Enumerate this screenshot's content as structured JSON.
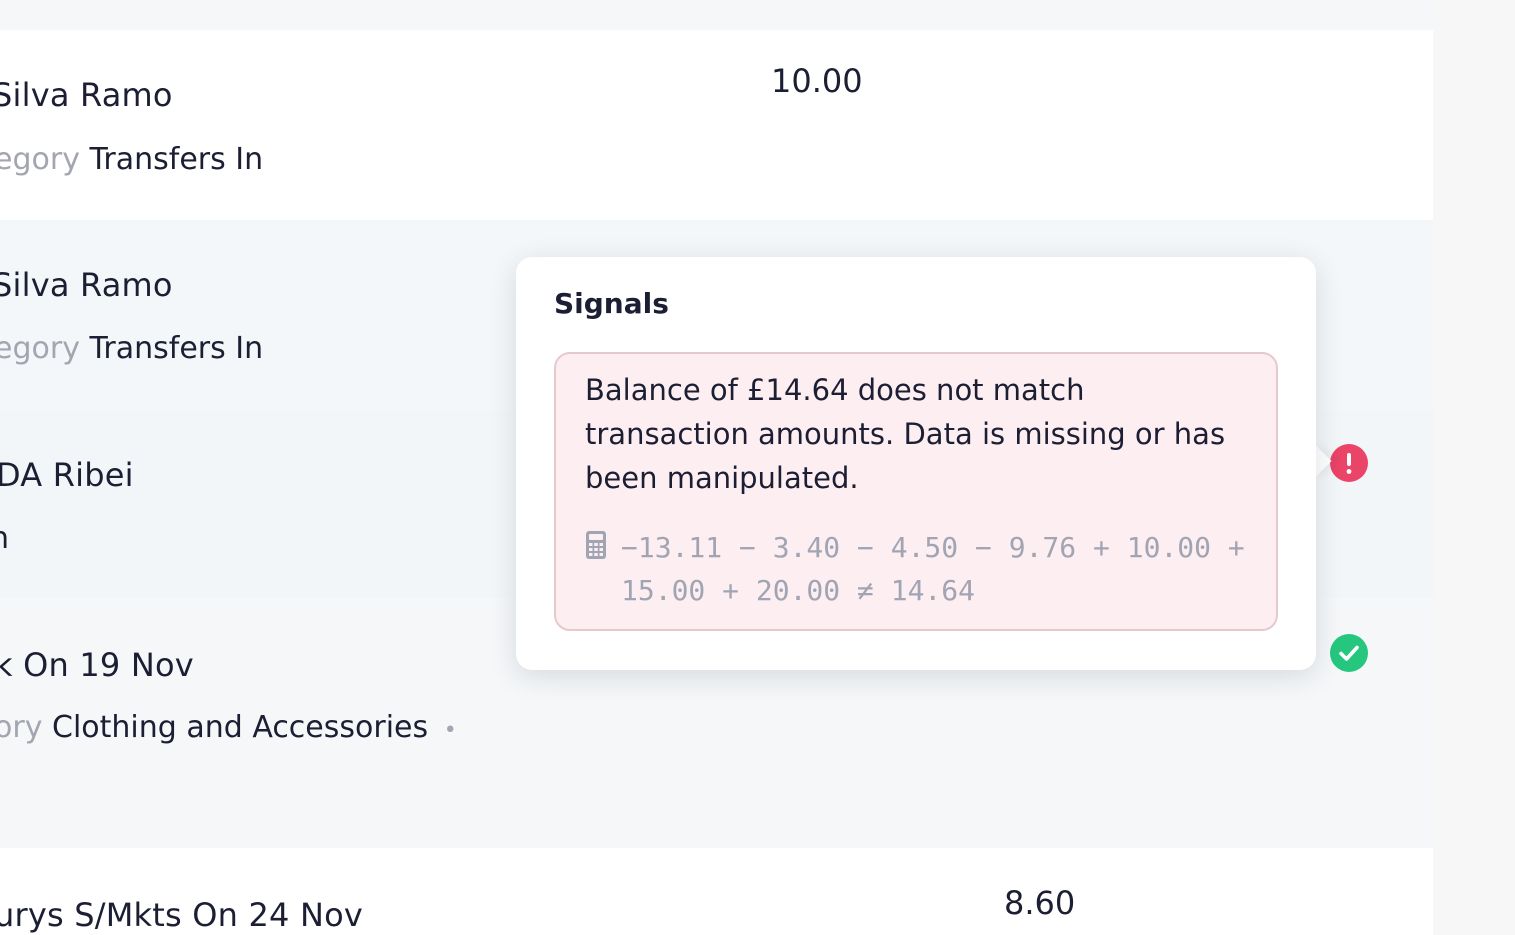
{
  "rows": [
    {
      "name": "Silva Ramo",
      "category_label": "egory",
      "category": "Transfers In",
      "amount": "10.00"
    },
    {
      "name": "Silva Ramo",
      "category_label": "egory",
      "category": "Transfers In"
    },
    {
      "name": "DA Ribei",
      "category": "n"
    },
    {
      "name": "k On 19 Nov",
      "category_label": "ory",
      "category": "Clothing and Accessories",
      "separator": "•"
    },
    {
      "name": "urys S/Mkts On 24 Nov",
      "amount": "8.60"
    }
  ],
  "popover": {
    "title": "Signals",
    "signal": {
      "message": "Balance of £14.64 does not match transaction amounts. Data is missing or has been manipulated.",
      "formula": "−13.11 − 3.40 − 4.50 − 9.76 + 10.00 + 15.00 + 20.00 ≠ 14.64",
      "icon": "calculator-icon",
      "color_bg": "#fdeef1",
      "color_border": "#e6c9cf"
    }
  },
  "status_icons": [
    {
      "type": "error",
      "icon": "exclamation-icon",
      "color": "#ea4468"
    },
    {
      "type": "ok",
      "icon": "checkmark-icon",
      "color": "#25c77e"
    }
  ]
}
